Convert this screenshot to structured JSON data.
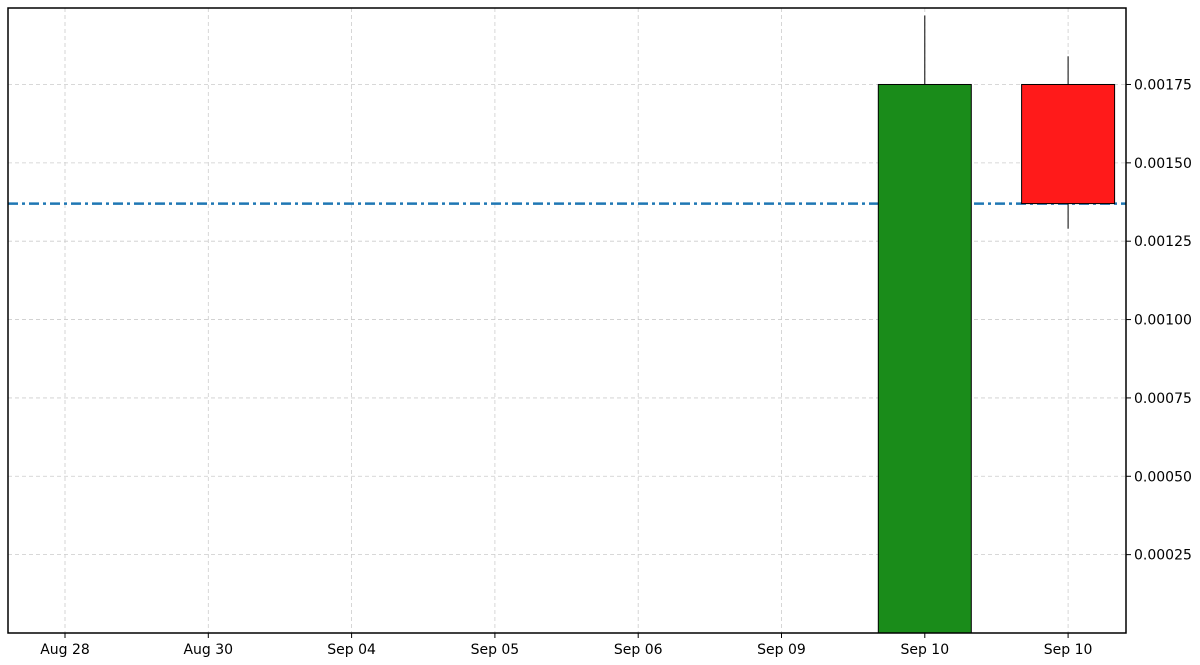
{
  "chart_data": {
    "type": "candlestick",
    "title": "",
    "xlabel": "",
    "ylabel": "",
    "categories": [
      "Aug 28",
      "Aug 30",
      "Sep 04",
      "Sep 05",
      "Sep 06",
      "Sep 09",
      "Sep 10",
      "Sep 10"
    ],
    "candles": [
      {
        "index": 6,
        "open": 0.0,
        "close": 0.00175,
        "high": 0.00197,
        "low": 0.0,
        "direction": "up"
      },
      {
        "index": 7,
        "open": 0.00175,
        "close": 0.00137,
        "high": 0.00184,
        "low": 0.00129,
        "direction": "down"
      }
    ],
    "reference_line": {
      "value": 0.00137,
      "style": "dash-dot",
      "color": "#1f77b4"
    },
    "y_ticks": [
      0.00025,
      0.0005,
      0.00075,
      0.001,
      0.00125,
      0.0015,
      0.00175
    ],
    "y_tick_labels": [
      "0.00025",
      "0.00050",
      "0.00075",
      "0.00100",
      "0.00125",
      "0.00150",
      "0.00175"
    ],
    "ylim": [
      0,
      0.001994
    ],
    "y_axis_position": "right",
    "grid": true,
    "colors": {
      "up": "#1a8c1a",
      "down": "#ff1a1a",
      "edge": "#000000",
      "grid": "#cccccc"
    }
  }
}
